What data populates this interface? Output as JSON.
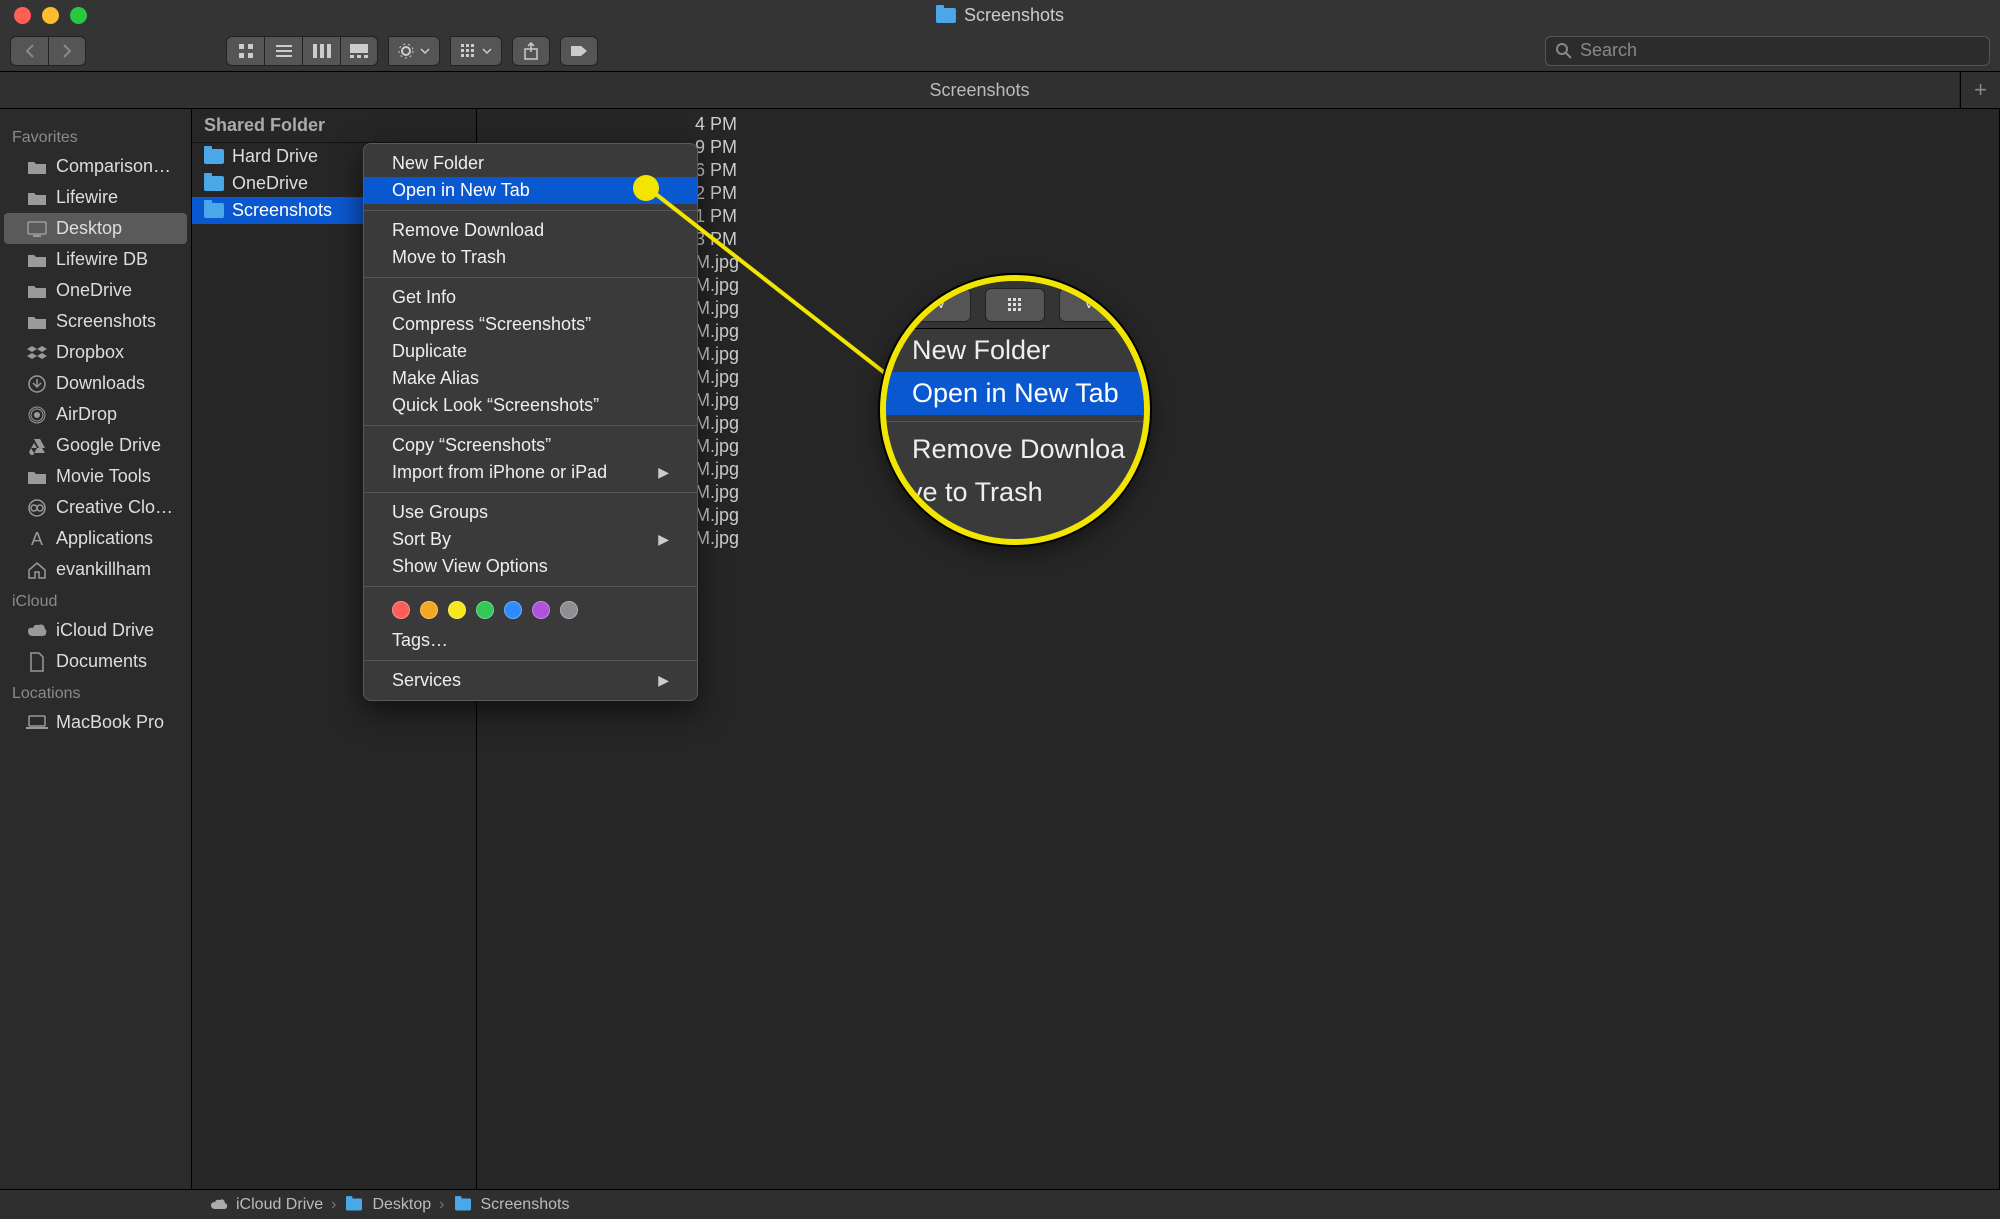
{
  "window": {
    "title": "Screenshots"
  },
  "search": {
    "placeholder": "Search"
  },
  "tabs": [
    {
      "label": "Screenshots"
    }
  ],
  "sidebar": {
    "sections": [
      {
        "header": "Favorites",
        "items": [
          {
            "label": "Comparison…",
            "icon": "folder"
          },
          {
            "label": "Lifewire",
            "icon": "folder"
          },
          {
            "label": "Desktop",
            "icon": "desktop",
            "selected": true
          },
          {
            "label": "Lifewire DB",
            "icon": "folder"
          },
          {
            "label": "OneDrive",
            "icon": "folder"
          },
          {
            "label": "Screenshots",
            "icon": "folder"
          },
          {
            "label": "Dropbox",
            "icon": "dropbox"
          },
          {
            "label": "Downloads",
            "icon": "downloads"
          },
          {
            "label": "AirDrop",
            "icon": "airdrop"
          },
          {
            "label": "Google Drive",
            "icon": "gdrive"
          },
          {
            "label": "Movie Tools",
            "icon": "folder"
          },
          {
            "label": "Creative Clo…",
            "icon": "cc"
          },
          {
            "label": "Applications",
            "icon": "apps"
          },
          {
            "label": "evankillham",
            "icon": "home"
          }
        ]
      },
      {
        "header": "iCloud",
        "items": [
          {
            "label": "iCloud Drive",
            "icon": "cloud"
          },
          {
            "label": "Documents",
            "icon": "doc"
          }
        ]
      },
      {
        "header": "Locations",
        "items": [
          {
            "label": "MacBook Pro",
            "icon": "laptop"
          }
        ]
      }
    ]
  },
  "columns": {
    "col1": {
      "header": "Shared Folder",
      "items": [
        {
          "label": "Hard Drive",
          "selected": false
        },
        {
          "label": "OneDrive",
          "selected": false
        },
        {
          "label": "Screenshots",
          "selected": true
        }
      ]
    },
    "partial_files": [
      "4 PM",
      "9 PM",
      "6 PM",
      "2 PM",
      "1 PM",
      "3 PM",
      "M.jpg",
      "M.jpg",
      "M.jpg",
      "M.jpg",
      "M.jpg",
      "M.jpg",
      "M.jpg",
      "M.jpg",
      "M.jpg",
      "M.jpg",
      "M.jpg",
      "M.jpg",
      "M.jpg"
    ]
  },
  "context_menu": {
    "groups": [
      [
        {
          "label": "New Folder"
        },
        {
          "label": "Open in New Tab",
          "highlight": true
        }
      ],
      [
        {
          "label": "Remove Download"
        },
        {
          "label": "Move to Trash"
        }
      ],
      [
        {
          "label": "Get Info"
        },
        {
          "label": "Compress “Screenshots”"
        },
        {
          "label": "Duplicate"
        },
        {
          "label": "Make Alias"
        },
        {
          "label": "Quick Look “Screenshots”"
        }
      ],
      [
        {
          "label": "Copy “Screenshots”"
        },
        {
          "label": "Import from iPhone or iPad",
          "submenu": true
        }
      ],
      [
        {
          "label": "Use Groups"
        },
        {
          "label": "Sort By",
          "submenu": true
        },
        {
          "label": "Show View Options"
        }
      ]
    ],
    "tag_colors": [
      "#ff5f57",
      "#f5a623",
      "#f8e71c",
      "#34c759",
      "#2e8bff",
      "#af52de",
      "#8e8e93"
    ],
    "tags_label": "Tags…",
    "services_label": "Services"
  },
  "bubble": {
    "items": [
      {
        "label": "New Folder"
      },
      {
        "label": "Open in New Tab",
        "highlight": true
      }
    ],
    "below_items": [
      {
        "label": "Remove Downloa"
      },
      {
        "label": "ove to Trash"
      }
    ]
  },
  "pathbar": [
    {
      "label": "iCloud Drive",
      "icon": "cloud"
    },
    {
      "label": "Desktop",
      "icon": "folder"
    },
    {
      "label": "Screenshots",
      "icon": "folder"
    }
  ]
}
